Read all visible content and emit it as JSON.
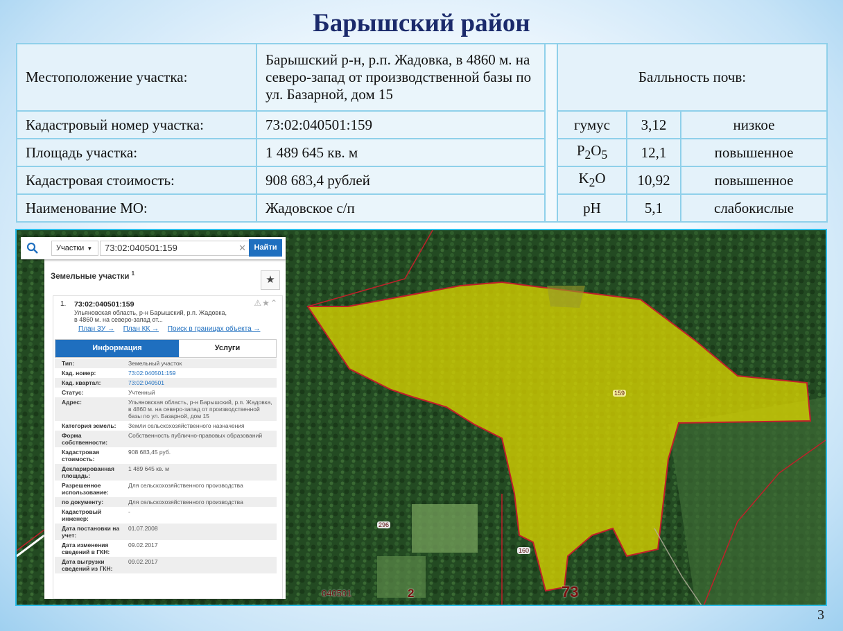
{
  "title": "Барышский район",
  "info": {
    "location_label": "Местоположение участка:",
    "location_value": "Барышский р-н, р.п. Жадовка, в 4860 м. на северо-запад от производственной базы по ул. Базарной, дом 15",
    "cadastral_label": "Кадастровый номер участка:",
    "cadastral_value": "73:02:040501:159",
    "area_label": "Площадь участка:",
    "area_value": "1 489 645 кв. м",
    "cost_label": "Кадастровая стоимость:",
    "cost_value": "908 683,4 рублей",
    "mo_label": "Наименование МО:",
    "mo_value": "Жадовское с/п"
  },
  "soil": {
    "header": "Балльность почв:",
    "rows": [
      {
        "name": "гумус",
        "value": "3,12",
        "level": "низкое"
      },
      {
        "name_main": "P",
        "name_sub1": "2",
        "name_mid": "O",
        "name_sub2": "5",
        "value": "12,1",
        "level": "повышенное"
      },
      {
        "name_main": "K",
        "name_sub1": "2",
        "name_mid": "O",
        "value": "10,92",
        "level": "повышенное"
      },
      {
        "name": "pH",
        "value": "5,1",
        "level": "слабокислые"
      }
    ]
  },
  "map": {
    "search": {
      "select_value": "Участки",
      "query": "73:02:040501:159",
      "find_button": "Найти"
    },
    "panel_title": "Земельные участки",
    "panel_count": "1",
    "result": {
      "index": "1.",
      "cadastral": "73:02:040501:159",
      "address": "Ульяновская область, р-н Барышский, р.п. Жадовка, в 4860 м. на северо-запад от...",
      "links": [
        "План ЗУ →",
        "План КК →",
        "Поиск в границах объекта →"
      ],
      "tab_info": "Информация",
      "tab_services": "Услуги",
      "attributes": [
        {
          "k": "Тип:",
          "v": "Земельный участок"
        },
        {
          "k": "Кад. номер:",
          "v": "73:02:040501:159"
        },
        {
          "k": "Кад. квартал:",
          "v": "73:02:040501"
        },
        {
          "k": "Статус:",
          "v": "Учтенный"
        },
        {
          "k": "Адрес:",
          "v": "Ульяновская область, р-н Барышский, р.п. Жадовка, в 4860 м. на северо-запад от производственной базы по ул. Базарной, дом 15"
        },
        {
          "k": "Категория земель:",
          "v": "Земли сельскохозяйственного назначения"
        },
        {
          "k": "Форма собственности:",
          "v": "Собственность публично-правовых образований"
        },
        {
          "k": "Кадастровая стоимость:",
          "v": "908 683,45 руб."
        },
        {
          "k": "Декларированная площадь:",
          "v": "1 489 645 кв. м"
        },
        {
          "k": "Разрешенное использование:",
          "v": "Для сельскохозяйственного производства"
        },
        {
          "k": "по документу:",
          "v": "Для сельскохозяйственного производства"
        },
        {
          "k": "Кадастровый инженер:",
          "v": "-"
        },
        {
          "k": "Дата постановки на учет:",
          "v": "01.07.2008"
        },
        {
          "k": "Дата изменения сведений в ГКН:",
          "v": "09.02.2017"
        },
        {
          "k": "Дата выгрузки сведений из ГКН:",
          "v": "09.02.2017"
        }
      ]
    },
    "labels": {
      "parcel_159": "159",
      "parcel_296": "296",
      "parcel_160": "160",
      "quarter": "040501",
      "district": "2",
      "region": "73"
    },
    "colors": {
      "parcel_fill": "#d9d200",
      "boundary": "#c0202a",
      "accent_blue": "#1f6fbf"
    }
  },
  "page_number": "3"
}
